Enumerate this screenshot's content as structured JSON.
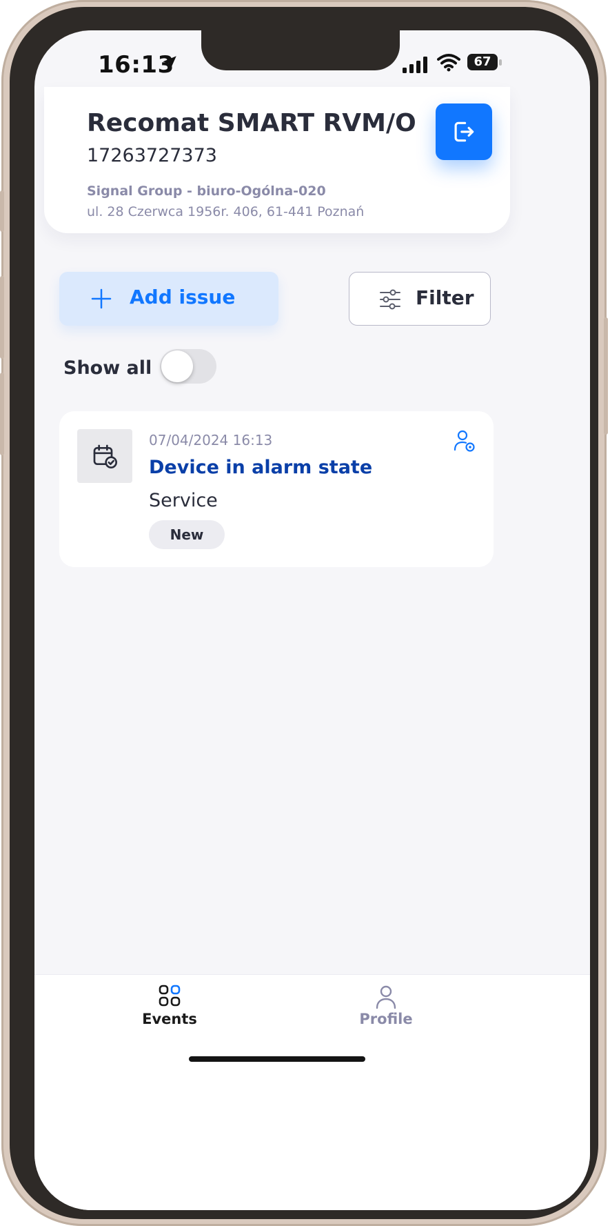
{
  "status_bar": {
    "time": "16:13",
    "battery": "67"
  },
  "header": {
    "title": "Recomat SMART RVM/O",
    "serial": "17263727373",
    "location": "Signal Group - biuro-Ogólna-020",
    "address": "ul. 28 Czerwca 1956r. 406, 61-441 Poznań"
  },
  "actions": {
    "add_issue": "Add issue",
    "filter": "Filter"
  },
  "show_all": {
    "label": "Show all",
    "enabled": false
  },
  "issues": [
    {
      "date": "07/04/2024 16:13",
      "title": "Device in alarm state",
      "type": "Service",
      "status": "New"
    }
  ],
  "bottom_nav": {
    "items": [
      {
        "label": "Events",
        "active": true
      },
      {
        "label": "Profile",
        "active": false
      }
    ]
  },
  "colors": {
    "accent": "#1177ff",
    "title_blue": "#0a3fa8",
    "muted": "#8a8aa8",
    "text": "#2a2d3b"
  }
}
